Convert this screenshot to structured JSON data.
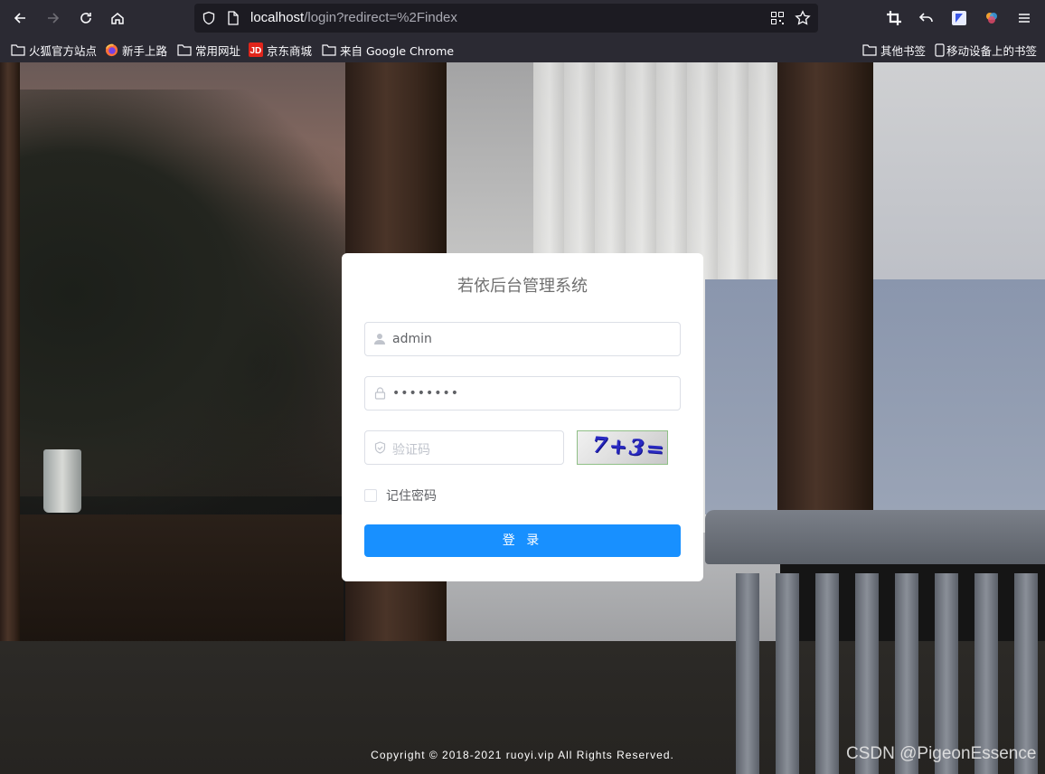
{
  "browser": {
    "url_host": "localhost",
    "url_path": "/login?redirect=%2Findex",
    "bookmarks": [
      {
        "label": "火狐官方站点",
        "icon": "folder-icon"
      },
      {
        "label": "新手上路",
        "icon": "firefox-icon"
      },
      {
        "label": "常用网址",
        "icon": "folder-icon"
      },
      {
        "label": "京东商城",
        "icon": "jd-icon"
      },
      {
        "label": "来自 Google Chrome",
        "icon": "folder-icon"
      }
    ],
    "bookmarks_right": [
      {
        "label": "其他书签",
        "icon": "folder-icon"
      },
      {
        "label": "移动设备上的书签",
        "icon": "mobile-icon"
      }
    ]
  },
  "login": {
    "title": "若依后台管理系统",
    "username_value": "admin",
    "password_value": "••••••••",
    "captcha_placeholder": "验证码",
    "captcha_image_text": "7+3=?",
    "remember_label": "记住密码",
    "submit_label": "登 录"
  },
  "footer": {
    "copyright": "Copyright © 2018-2021 ruoyi.vip All Rights Reserved."
  },
  "watermark": "CSDN @PigeonEssence",
  "colors": {
    "primary": "#1890ff",
    "card_bg": "#ffffff",
    "chrome_bg": "#2b2a33"
  }
}
